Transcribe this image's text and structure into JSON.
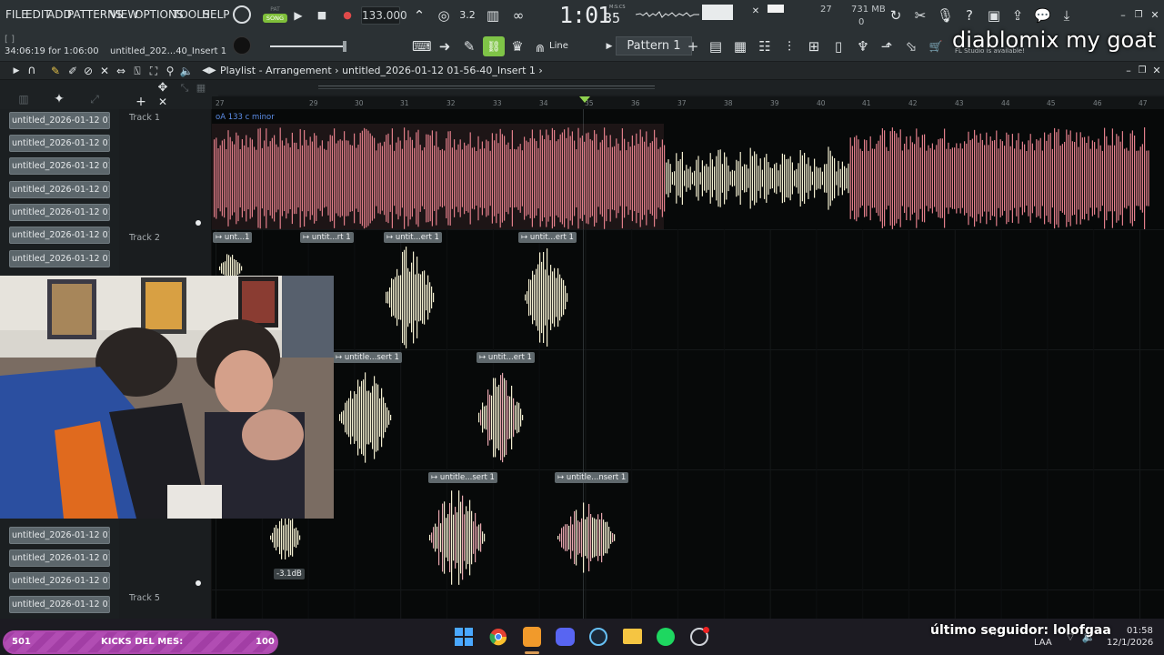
{
  "menu": [
    "FILE",
    "EDIT",
    "ADD",
    "PATTERNS",
    "VIEW",
    "OPTIONS",
    "TOOLS",
    "HELP"
  ],
  "pat_song": {
    "pat": "PAT",
    "song": "SONG"
  },
  "tempo": "133.000",
  "time": {
    "main": "1:01",
    "sub": "35",
    "unit": "M:S:CS"
  },
  "cpu": {
    "value": "27"
  },
  "memory": {
    "value": "731 MB",
    "polyphony": "0"
  },
  "hint": {
    "left_time": "34:06:19 for 1:06:00",
    "file": "untitled_202...40_Insert 1"
  },
  "snap": {
    "label": "Line"
  },
  "pattern": {
    "label": "Pattern 1"
  },
  "news_text": "FL Studio is available!",
  "watermark": "diablomix my goat",
  "playlist": {
    "title": "Playlist - Arrangement",
    "breadcrumb": "untitled_2026-01-12 01-56-40_Insert 1",
    "ruler_bars": [
      "27",
      "29",
      "30",
      "31",
      "32",
      "33",
      "34",
      "35",
      "36",
      "37",
      "38",
      "39",
      "40",
      "41",
      "42",
      "43",
      "44",
      "45",
      "46",
      "47"
    ],
    "clip_key": "oA 133 c minor"
  },
  "channels": [
    "untitled_2026-01-12 01-...",
    "untitled_2026-01-12 01-...",
    "untitled_2026-01-12 01-...",
    "untitled_2026-01-12 01-...",
    "untitled_2026-01-12 01-...",
    "untitled_2026-01-12 01-...",
    "untitled_2026-01-12 01-...",
    "untitled_2026-01-12 01-...",
    "untitled_2026-01-12 01-...",
    "untitled_2026-01-12 01-...",
    "untitled_2026-01-12 01-..."
  ],
  "tracks": [
    "Track 1",
    "Track 2",
    "Track 5"
  ],
  "clips": [
    "unt...1",
    "untit...rt 1",
    "untit...ert 1",
    "untit...ert 1",
    "untitle...sert 1",
    "untit...ert 1",
    "untitle...sert 1",
    "untitle...nsert 1"
  ],
  "volume_readout": "-3.1dB",
  "stream": {
    "kicks_left": "501",
    "kicks_label": "KICKS DEL MES:",
    "kicks_goal": "100",
    "follower": "último seguidor: lolofgaa"
  },
  "tray": {
    "lang": "LAA",
    "time": "01:58",
    "date": "12/1/2026"
  },
  "colors": {
    "accent_green": "#7fc447",
    "wave_red": "#e17e8a",
    "wave_cream": "#f2eed0",
    "kick_purple": "#ad48ad"
  }
}
